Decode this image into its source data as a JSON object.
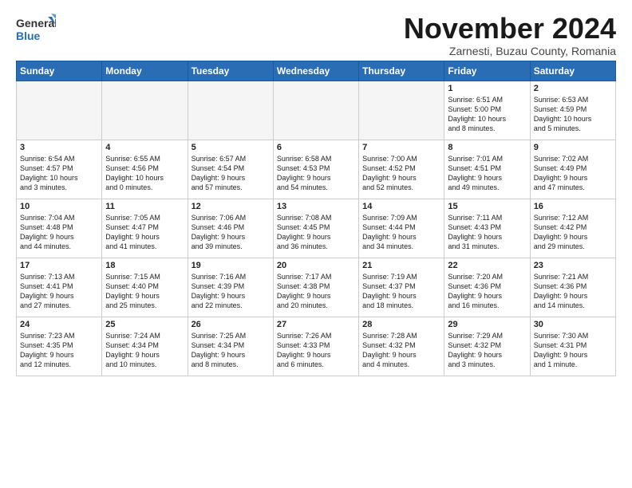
{
  "logo": {
    "general": "General",
    "blue": "Blue"
  },
  "title": "November 2024",
  "subtitle": "Zarnesti, Buzau County, Romania",
  "days_header": [
    "Sunday",
    "Monday",
    "Tuesday",
    "Wednesday",
    "Thursday",
    "Friday",
    "Saturday"
  ],
  "weeks": [
    [
      {
        "num": "",
        "info": "",
        "empty": true
      },
      {
        "num": "",
        "info": "",
        "empty": true
      },
      {
        "num": "",
        "info": "",
        "empty": true
      },
      {
        "num": "",
        "info": "",
        "empty": true
      },
      {
        "num": "",
        "info": "",
        "empty": true
      },
      {
        "num": "1",
        "info": "Sunrise: 6:51 AM\nSunset: 5:00 PM\nDaylight: 10 hours\nand 8 minutes.",
        "empty": false
      },
      {
        "num": "2",
        "info": "Sunrise: 6:53 AM\nSunset: 4:59 PM\nDaylight: 10 hours\nand 5 minutes.",
        "empty": false
      }
    ],
    [
      {
        "num": "3",
        "info": "Sunrise: 6:54 AM\nSunset: 4:57 PM\nDaylight: 10 hours\nand 3 minutes.",
        "empty": false
      },
      {
        "num": "4",
        "info": "Sunrise: 6:55 AM\nSunset: 4:56 PM\nDaylight: 10 hours\nand 0 minutes.",
        "empty": false
      },
      {
        "num": "5",
        "info": "Sunrise: 6:57 AM\nSunset: 4:54 PM\nDaylight: 9 hours\nand 57 minutes.",
        "empty": false
      },
      {
        "num": "6",
        "info": "Sunrise: 6:58 AM\nSunset: 4:53 PM\nDaylight: 9 hours\nand 54 minutes.",
        "empty": false
      },
      {
        "num": "7",
        "info": "Sunrise: 7:00 AM\nSunset: 4:52 PM\nDaylight: 9 hours\nand 52 minutes.",
        "empty": false
      },
      {
        "num": "8",
        "info": "Sunrise: 7:01 AM\nSunset: 4:51 PM\nDaylight: 9 hours\nand 49 minutes.",
        "empty": false
      },
      {
        "num": "9",
        "info": "Sunrise: 7:02 AM\nSunset: 4:49 PM\nDaylight: 9 hours\nand 47 minutes.",
        "empty": false
      }
    ],
    [
      {
        "num": "10",
        "info": "Sunrise: 7:04 AM\nSunset: 4:48 PM\nDaylight: 9 hours\nand 44 minutes.",
        "empty": false
      },
      {
        "num": "11",
        "info": "Sunrise: 7:05 AM\nSunset: 4:47 PM\nDaylight: 9 hours\nand 41 minutes.",
        "empty": false
      },
      {
        "num": "12",
        "info": "Sunrise: 7:06 AM\nSunset: 4:46 PM\nDaylight: 9 hours\nand 39 minutes.",
        "empty": false
      },
      {
        "num": "13",
        "info": "Sunrise: 7:08 AM\nSunset: 4:45 PM\nDaylight: 9 hours\nand 36 minutes.",
        "empty": false
      },
      {
        "num": "14",
        "info": "Sunrise: 7:09 AM\nSunset: 4:44 PM\nDaylight: 9 hours\nand 34 minutes.",
        "empty": false
      },
      {
        "num": "15",
        "info": "Sunrise: 7:11 AM\nSunset: 4:43 PM\nDaylight: 9 hours\nand 31 minutes.",
        "empty": false
      },
      {
        "num": "16",
        "info": "Sunrise: 7:12 AM\nSunset: 4:42 PM\nDaylight: 9 hours\nand 29 minutes.",
        "empty": false
      }
    ],
    [
      {
        "num": "17",
        "info": "Sunrise: 7:13 AM\nSunset: 4:41 PM\nDaylight: 9 hours\nand 27 minutes.",
        "empty": false
      },
      {
        "num": "18",
        "info": "Sunrise: 7:15 AM\nSunset: 4:40 PM\nDaylight: 9 hours\nand 25 minutes.",
        "empty": false
      },
      {
        "num": "19",
        "info": "Sunrise: 7:16 AM\nSunset: 4:39 PM\nDaylight: 9 hours\nand 22 minutes.",
        "empty": false
      },
      {
        "num": "20",
        "info": "Sunrise: 7:17 AM\nSunset: 4:38 PM\nDaylight: 9 hours\nand 20 minutes.",
        "empty": false
      },
      {
        "num": "21",
        "info": "Sunrise: 7:19 AM\nSunset: 4:37 PM\nDaylight: 9 hours\nand 18 minutes.",
        "empty": false
      },
      {
        "num": "22",
        "info": "Sunrise: 7:20 AM\nSunset: 4:36 PM\nDaylight: 9 hours\nand 16 minutes.",
        "empty": false
      },
      {
        "num": "23",
        "info": "Sunrise: 7:21 AM\nSunset: 4:36 PM\nDaylight: 9 hours\nand 14 minutes.",
        "empty": false
      }
    ],
    [
      {
        "num": "24",
        "info": "Sunrise: 7:23 AM\nSunset: 4:35 PM\nDaylight: 9 hours\nand 12 minutes.",
        "empty": false
      },
      {
        "num": "25",
        "info": "Sunrise: 7:24 AM\nSunset: 4:34 PM\nDaylight: 9 hours\nand 10 minutes.",
        "empty": false
      },
      {
        "num": "26",
        "info": "Sunrise: 7:25 AM\nSunset: 4:34 PM\nDaylight: 9 hours\nand 8 minutes.",
        "empty": false
      },
      {
        "num": "27",
        "info": "Sunrise: 7:26 AM\nSunset: 4:33 PM\nDaylight: 9 hours\nand 6 minutes.",
        "empty": false
      },
      {
        "num": "28",
        "info": "Sunrise: 7:28 AM\nSunset: 4:32 PM\nDaylight: 9 hours\nand 4 minutes.",
        "empty": false
      },
      {
        "num": "29",
        "info": "Sunrise: 7:29 AM\nSunset: 4:32 PM\nDaylight: 9 hours\nand 3 minutes.",
        "empty": false
      },
      {
        "num": "30",
        "info": "Sunrise: 7:30 AM\nSunset: 4:31 PM\nDaylight: 9 hours\nand 1 minute.",
        "empty": false
      }
    ]
  ]
}
